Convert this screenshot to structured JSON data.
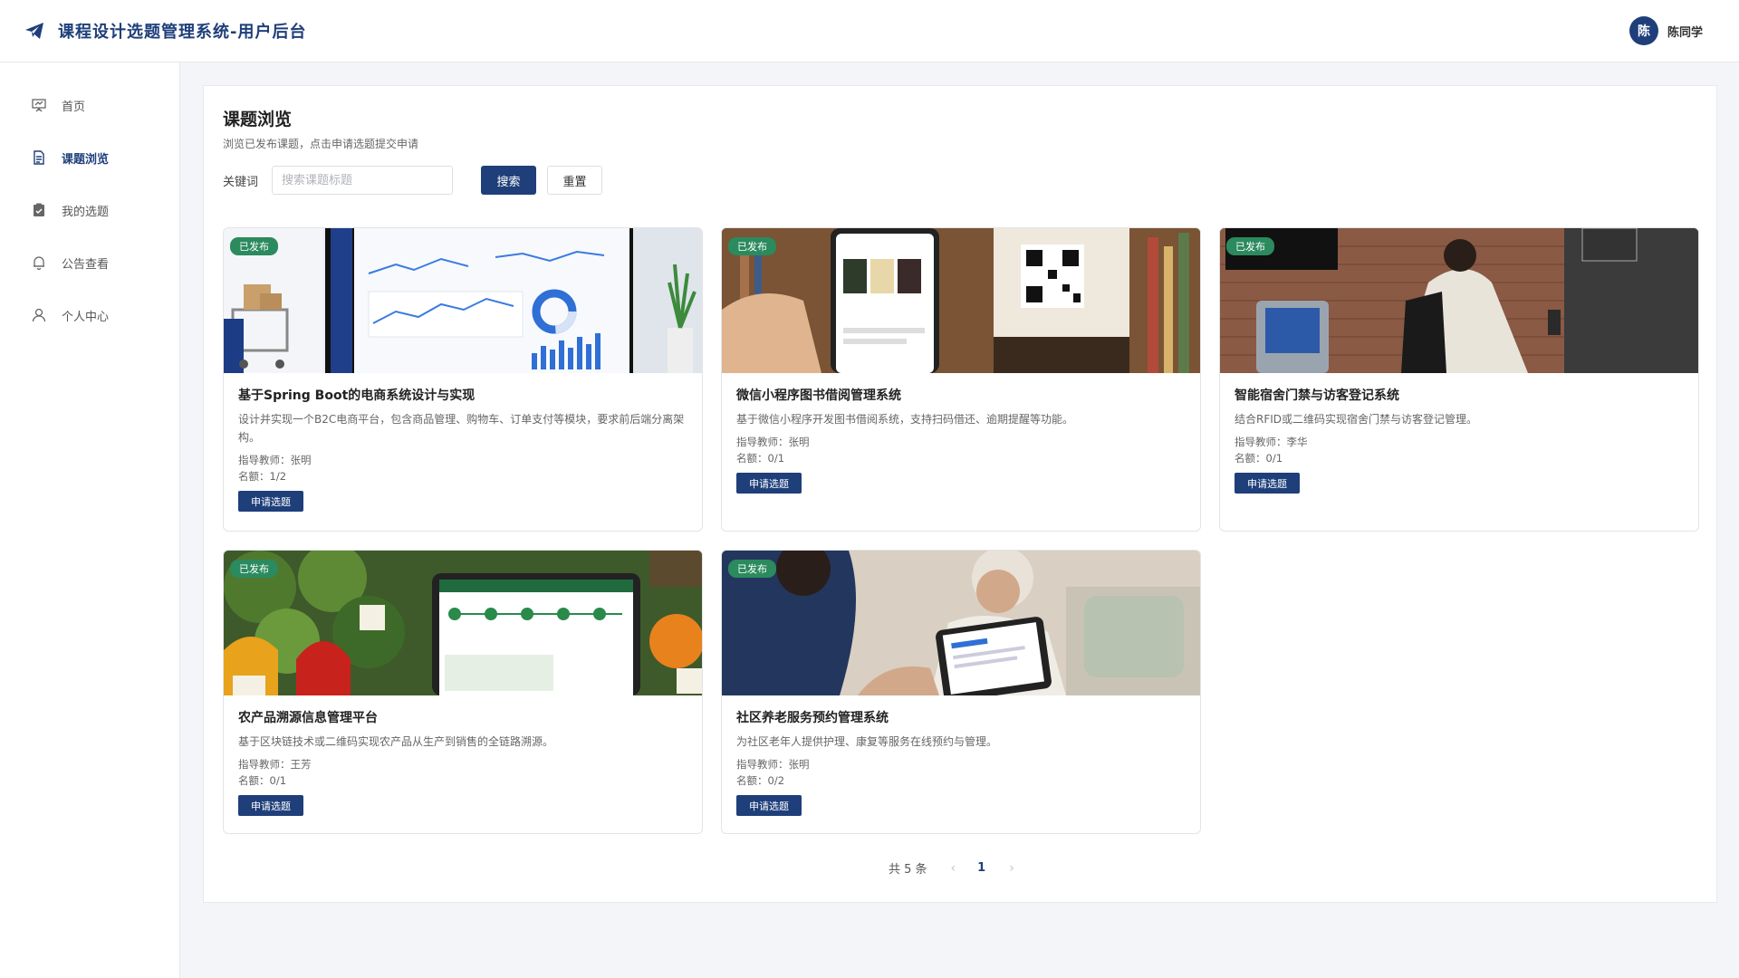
{
  "header": {
    "title": "课程设计选题管理系统-用户后台",
    "avatar_text": "陈",
    "user_name": "陈同学"
  },
  "sidebar": {
    "items": [
      {
        "label": "首页",
        "icon": "presentation-icon"
      },
      {
        "label": "课题浏览",
        "icon": "document-icon",
        "active": true
      },
      {
        "label": "我的选题",
        "icon": "clipboard-check-icon"
      },
      {
        "label": "公告查看",
        "icon": "bell-icon"
      },
      {
        "label": "个人中心",
        "icon": "user-icon"
      }
    ]
  },
  "main": {
    "title": "课题浏览",
    "subtitle": "浏览已发布课题，点击申请选题提交申请",
    "search": {
      "label": "关键词",
      "placeholder": "搜索课题标题",
      "value": "",
      "search_button": "搜索",
      "reset_button": "重置"
    },
    "cards": [
      {
        "status": "已发布",
        "title": "基于Spring Boot的电商系统设计与实现",
        "description": "设计并实现一个B2C电商平台，包含商品管理、购物车、订单支付等模块，要求前后端分离架构。",
        "teacher": "指导教师：张明",
        "quota": "名额：1/2",
        "apply": "申请选题"
      },
      {
        "status": "已发布",
        "title": "微信小程序图书借阅管理系统",
        "description": "基于微信小程序开发图书借阅系统，支持扫码借还、逾期提醒等功能。",
        "teacher": "指导教师：张明",
        "quota": "名额：0/1",
        "apply": "申请选题"
      },
      {
        "status": "已发布",
        "title": "智能宿舍门禁与访客登记系统",
        "description": "结合RFID或二维码实现宿舍门禁与访客登记管理。",
        "teacher": "指导教师：李华",
        "quota": "名额：0/1",
        "apply": "申请选题"
      },
      {
        "status": "已发布",
        "title": "农产品溯源信息管理平台",
        "description": "基于区块链技术或二维码实现农产品从生产到销售的全链路溯源。",
        "teacher": "指导教师：王芳",
        "quota": "名额：0/1",
        "apply": "申请选题"
      },
      {
        "status": "已发布",
        "title": "社区养老服务预约管理系统",
        "description": "为社区老年人提供护理、康复等服务在线预约与管理。",
        "teacher": "指导教师：张明",
        "quota": "名额：0/2",
        "apply": "申请选题"
      }
    ],
    "pagination": {
      "total": "共 5 条",
      "current": "1"
    }
  },
  "colors": {
    "primary": "#1f3f7a",
    "badge": "#2b8a5e",
    "background": "#f4f5f8"
  }
}
